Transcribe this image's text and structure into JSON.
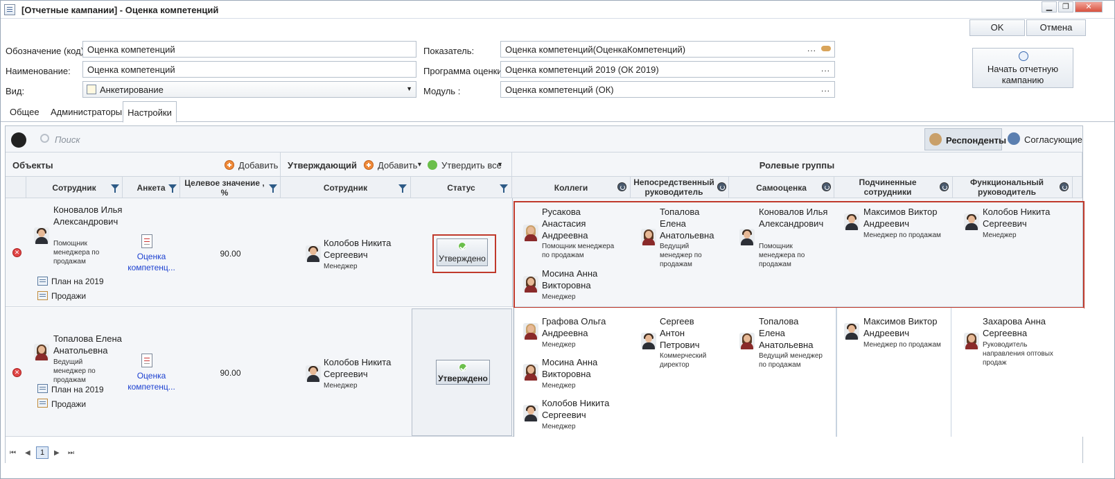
{
  "window": {
    "title": "[Отчетные кампании] - Оценка компетенций"
  },
  "actions": {
    "ok": "OK",
    "cancel": "Отмена",
    "start": "Начать отчетную кампанию"
  },
  "form": {
    "code_label": "Обозначение (код):",
    "code_value": "Оценка компетенций",
    "name_label": "Наименование:",
    "name_value": "Оценка компетенций",
    "kind_label": "Вид:",
    "kind_value": "Анкетирование",
    "indicator_label": "Показатель:",
    "indicator_value": "Оценка компетенций(ОценкаКомпетенций)",
    "program_label": "Программа оценки :",
    "program_value": "Оценка компетенций 2019 (ОК 2019)",
    "module_label": "Модуль :",
    "module_value": "Оценка компетенций (ОК)"
  },
  "tabs": [
    "Общее",
    "Администраторы",
    "Настройки"
  ],
  "toolbar": {
    "search_placeholder": "Поиск",
    "respondents": "Респонденты",
    "approvers": "Согласующие"
  },
  "sections": {
    "objects": "Объекты",
    "add": "Добавить",
    "approver": "Утверждающий",
    "add2": "Добавить",
    "approve_all": "Утвердить все",
    "role_groups": "Ролевые группы"
  },
  "columns": {
    "employee": "Сотрудник",
    "survey": "Анкета",
    "target": "Целевое значение , %",
    "employee2": "Сотрудник",
    "status": "Статус",
    "colleagues": "Коллеги",
    "direct": "Непосредственный руководитель",
    "self": "Самооценка",
    "subordinates": "Подчиненные сотрудники",
    "functional": "Функциональный руководитель"
  },
  "rows": [
    {
      "emp_name": "Коновалов Илья Александрович",
      "emp_pos": "Помощник менеджера по продажам",
      "plan": "План на 2019",
      "sales": "Продажи",
      "survey": "Оценка компетенц...",
      "target": "90.00",
      "appr_name": "Колобов Никита Сергеевич",
      "appr_pos": "Менеджер",
      "status": "Утверждено",
      "colleagues": [
        {
          "name": "Русакова Анастасия Андреевна",
          "pos": "Помощник менеджера по продажам"
        },
        {
          "name": "Мосина Анна Викторовна",
          "pos": "Менеджер"
        }
      ],
      "direct": {
        "name": "Топалова Елена Анатольевна",
        "pos": "Ведущий менеджер по продажам"
      },
      "self": {
        "name": "Коновалов Илья Александрович",
        "pos": "Помощник менеджера по продажам"
      },
      "subordinates": {
        "name": "Максимов Виктор Андреевич",
        "pos": "Менеджер по продажам"
      },
      "functional": {
        "name": "Колобов Никита Сергеевич",
        "pos": "Менеджер"
      }
    },
    {
      "emp_name": "Топалова Елена Анатольевна",
      "emp_pos": "Ведущий менеджер по продажам",
      "plan": "План на 2019",
      "sales": "Продажи",
      "survey": "Оценка компетенц...",
      "target": "90.00",
      "appr_name": "Колобов Никита Сергеевич",
      "appr_pos": "Менеджер",
      "status": "Утверждено",
      "colleagues": [
        {
          "name": "Графова Ольга Андреевна",
          "pos": "Менеджер"
        },
        {
          "name": "Мосина Анна Викторовна",
          "pos": "Менеджер"
        },
        {
          "name": "Колобов Никита Сергеевич",
          "pos": "Менеджер"
        }
      ],
      "direct": {
        "name": "Сергеев Антон Петрович",
        "pos": "Коммерческий директор"
      },
      "self": {
        "name": "Топалова Елена Анатольевна",
        "pos": "Ведущий менеджер по продажам"
      },
      "subordinates": {
        "name": "Максимов Виктор Андреевич",
        "pos": "Менеджер по продажам"
      },
      "functional": {
        "name": "Захарова Анна Сергеевна",
        "pos": "Руководитель направления оптовых продаж"
      }
    }
  ],
  "pager": {
    "page": "1"
  },
  "colors": {
    "highlight": "#c0392b",
    "link": "#1a3fd0"
  }
}
